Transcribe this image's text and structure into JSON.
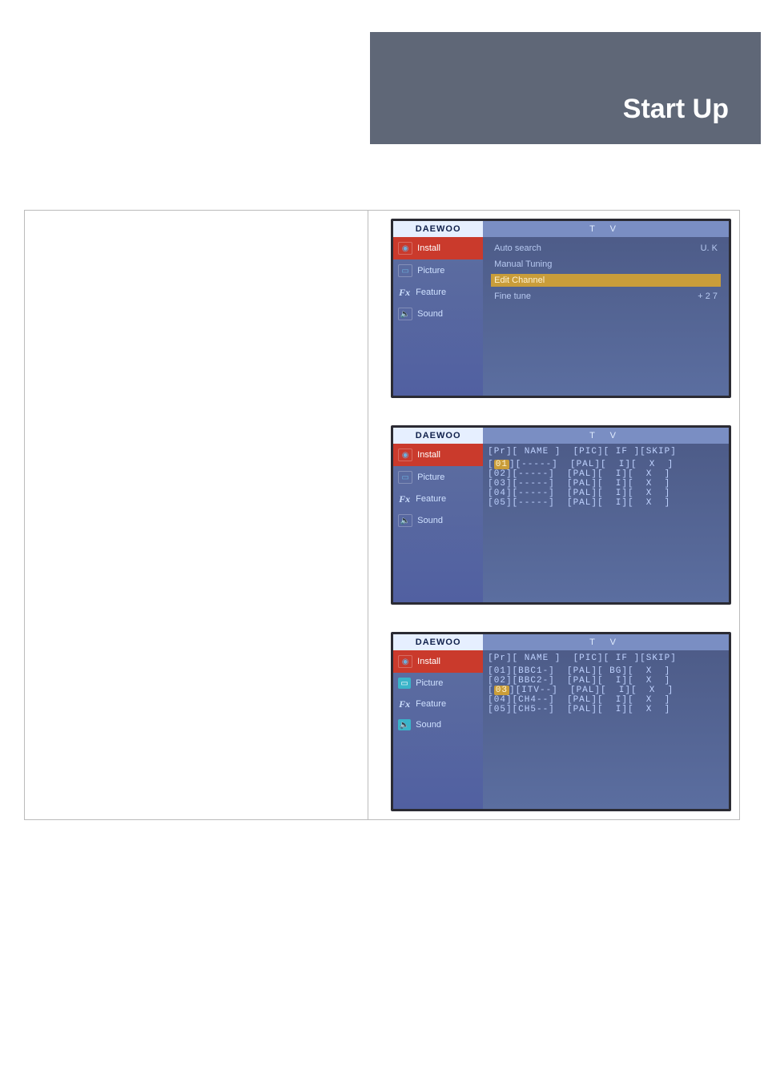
{
  "header": {
    "title": "Start Up"
  },
  "common": {
    "brand": "DAEWOO",
    "tv_label": "T  V",
    "sidebar": {
      "install": "Install",
      "picture": "Picture",
      "feature": "Feature",
      "sound": "Sound",
      "fx_glyph": "Fx"
    }
  },
  "shot1": {
    "menu": {
      "auto_search_label": "Auto search",
      "auto_search_value": "U. K",
      "manual_tuning": "Manual Tuning",
      "edit_channel": "Edit Channel",
      "fine_tune_label": "Fine tune",
      "fine_tune_value": "+ 2 7"
    }
  },
  "shot2": {
    "header": "[Pr][ NAME ]  [PIC][ IF ][SKIP]",
    "rows": [
      {
        "pr": "01",
        "name": "-----",
        "pic": "PAL",
        "if": "I",
        "skip": "X",
        "hl": true
      },
      {
        "pr": "02",
        "name": "-----",
        "pic": "PAL",
        "if": "I",
        "skip": "X",
        "hl": false
      },
      {
        "pr": "03",
        "name": "-----",
        "pic": "PAL",
        "if": "I",
        "skip": "X",
        "hl": false
      },
      {
        "pr": "04",
        "name": "-----",
        "pic": "PAL",
        "if": "I",
        "skip": "X",
        "hl": false
      },
      {
        "pr": "05",
        "name": "-----",
        "pic": "PAL",
        "if": "I",
        "skip": "X",
        "hl": false
      }
    ]
  },
  "shot3": {
    "header": "[Pr][ NAME ]  [PIC][ IF ][SKIP]",
    "rows": [
      {
        "pr": "01",
        "name": "BBC1-",
        "pic": "PAL",
        "if": "BG",
        "skip": "X",
        "hl": false
      },
      {
        "pr": "02",
        "name": "BBC2-",
        "pic": "PAL",
        "if": "I",
        "skip": "X",
        "hl": false
      },
      {
        "pr": "03",
        "name": "ITV--",
        "pic": "PAL",
        "if": "I",
        "skip": "X",
        "hl": true
      },
      {
        "pr": "04",
        "name": "CH4--",
        "pic": "PAL",
        "if": "I",
        "skip": "X",
        "hl": false
      },
      {
        "pr": "05",
        "name": "CH5--",
        "pic": "PAL",
        "if": "I",
        "skip": "X",
        "hl": false
      }
    ]
  }
}
